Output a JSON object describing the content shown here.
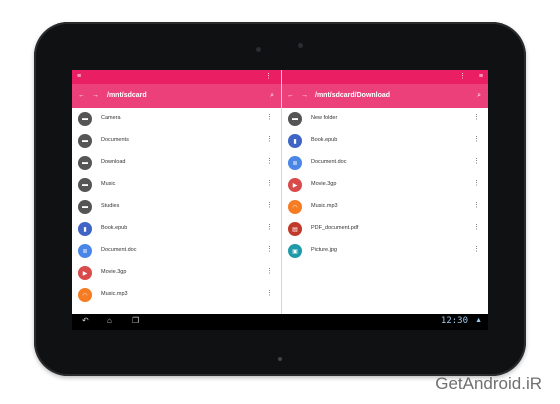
{
  "left_pane": {
    "path": "/mnt/sdcard",
    "items": [
      {
        "name": "Camera",
        "icon": "folder-icon",
        "color": "#555555"
      },
      {
        "name": "Documents",
        "icon": "folder-icon",
        "color": "#555555"
      },
      {
        "name": "Download",
        "icon": "folder-icon",
        "color": "#555555"
      },
      {
        "name": "Music",
        "icon": "folder-icon",
        "color": "#555555"
      },
      {
        "name": "Studies",
        "icon": "folder-icon",
        "color": "#555555"
      },
      {
        "name": "Book.epub",
        "icon": "book-icon",
        "color": "#3f64c6"
      },
      {
        "name": "Document.doc",
        "icon": "document-icon",
        "color": "#4a86e8"
      },
      {
        "name": "Movie.3gp",
        "icon": "video-icon",
        "color": "#d94a4a"
      },
      {
        "name": "Music.mp3",
        "icon": "headphones-icon",
        "color": "#f57c22"
      }
    ]
  },
  "right_pane": {
    "path": "/mnt/sdcard/Download",
    "items": [
      {
        "name": "New folder",
        "icon": "folder-icon",
        "color": "#555555"
      },
      {
        "name": "Book.epub",
        "icon": "book-icon",
        "color": "#3f64c6"
      },
      {
        "name": "Document.doc",
        "icon": "document-icon",
        "color": "#4a86e8"
      },
      {
        "name": "Movie.3gp",
        "icon": "video-icon",
        "color": "#d94a4a"
      },
      {
        "name": "Music.mp3",
        "icon": "headphones-icon",
        "color": "#f57c22"
      },
      {
        "name": "PDF_document.pdf",
        "icon": "pdf-icon",
        "color": "#c0392b"
      },
      {
        "name": "Picture.jpg",
        "icon": "image-icon",
        "color": "#1e9aa8"
      }
    ]
  },
  "status": {
    "clock": "12:30"
  },
  "watermark": "GetAndroid.iR",
  "colors": {
    "topbar": "#e91e63",
    "pathbar": "#ec407a"
  }
}
